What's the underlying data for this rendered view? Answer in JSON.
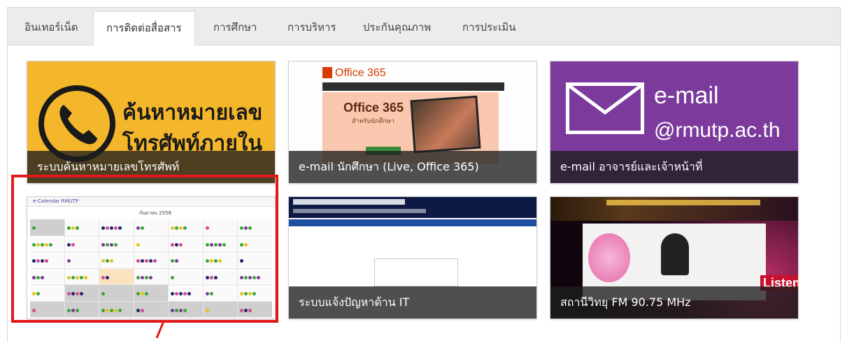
{
  "tabs": [
    {
      "label": "อินเทอร์เน็ต",
      "active": false
    },
    {
      "label": "การติดต่อสื่อสาร",
      "active": true
    },
    {
      "label": "การศึกษา",
      "active": false
    },
    {
      "label": "การบริหาร",
      "active": false
    },
    {
      "label": "ประกันคุณภาพ",
      "active": false
    },
    {
      "label": "การประเมิน",
      "active": false
    }
  ],
  "tiles": [
    {
      "caption": "ระบบค้นหาหมายเลขโทรศัพท์",
      "image_text_1": "ค้นหาหมายเลข",
      "image_text_2": "โทรศัพท์ภายใน",
      "bg": "#f4b62a"
    },
    {
      "caption": "e-mail นักศึกษา (Live, Office 365)",
      "image_text_1": "Office 365",
      "image_text_2": "Office 365",
      "image_text_3": "สำหรับนักศึกษา"
    },
    {
      "caption": "e-mail อาจารย์และเจ้าหน้าที่",
      "image_text_1": "e-mail",
      "image_text_2": "@rmutp.ac.th",
      "bg": "#7b3a9c"
    },
    {
      "caption": "",
      "image_text_1": "e-Calendar RMUTP",
      "image_text_2": "กันยายน 2558"
    },
    {
      "caption": "ระบบแจ้งปัญหาด้าน IT"
    },
    {
      "caption": "สถานีวิทยุ FM 90.75 MHz",
      "image_text_1": "Listen"
    }
  ],
  "colors": {
    "highlight": "#e3191b",
    "tab_bg": "#ececec",
    "caption_bg": "rgba(30,30,30,0.78)"
  }
}
